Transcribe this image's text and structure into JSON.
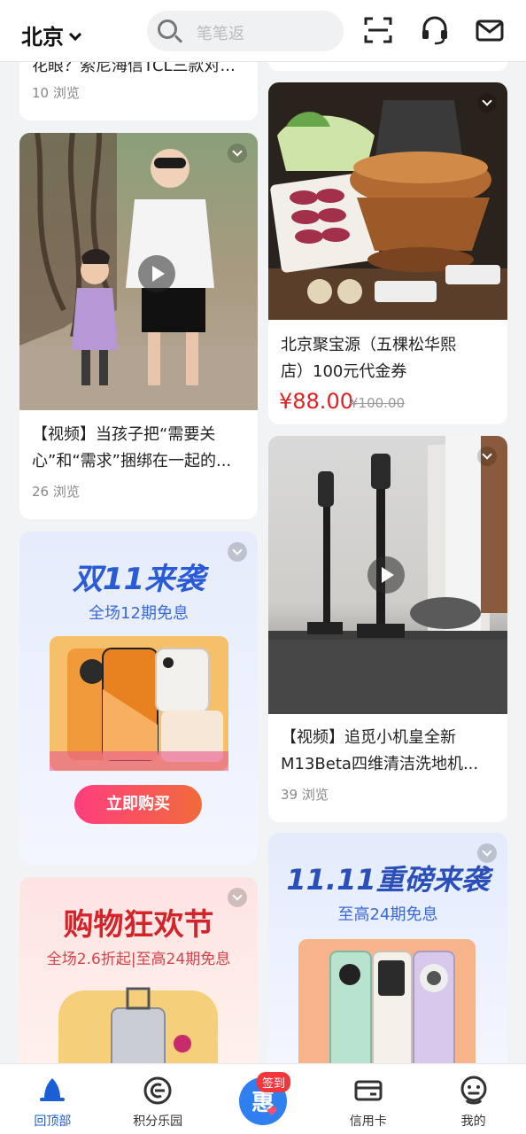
{
  "header": {
    "city": "北京",
    "search_placeholder": "笔笔返"
  },
  "cards": {
    "c1": {
      "title": "花眼？索尼海信TCL三款对...",
      "views": "10 浏览"
    },
    "c2": {
      "title_line1": "【视频】当孩子把“需要关",
      "title_line2": "心”和“需求”捆绑在一起的...",
      "views": "26 浏览"
    },
    "c3": {
      "headline": "双11来袭",
      "sub": "全场12期免息",
      "cta": "立即购买"
    },
    "c4": {
      "headline": "购物狂欢节",
      "sub": "全场2.6折起|至高24期免息"
    },
    "c5": {
      "title_line1": "北京聚宝源（五棵松华熙",
      "title_line2": "店）100元代金券",
      "price": "¥88.00",
      "orig_price": "¥100.00"
    },
    "c6": {
      "title_line1": "【视频】追觅小机皇全新",
      "title_line2": "M13Beta四维清洁洗地机...",
      "views": "39 浏览"
    },
    "c7": {
      "headline": "11.11重磅来袭",
      "sub": "至高24期免息"
    }
  },
  "tabbar": {
    "items": [
      {
        "label": "回顶部"
      },
      {
        "label": "积分乐园"
      },
      {
        "label": ""
      },
      {
        "label": "信用卡"
      },
      {
        "label": "我的"
      }
    ],
    "badge": "签到",
    "active_color": "#1a5fd6"
  },
  "colors": {
    "price": "#e02020",
    "brand_blue": "#2a5bd6",
    "cta_pink": "#f23b6e"
  }
}
